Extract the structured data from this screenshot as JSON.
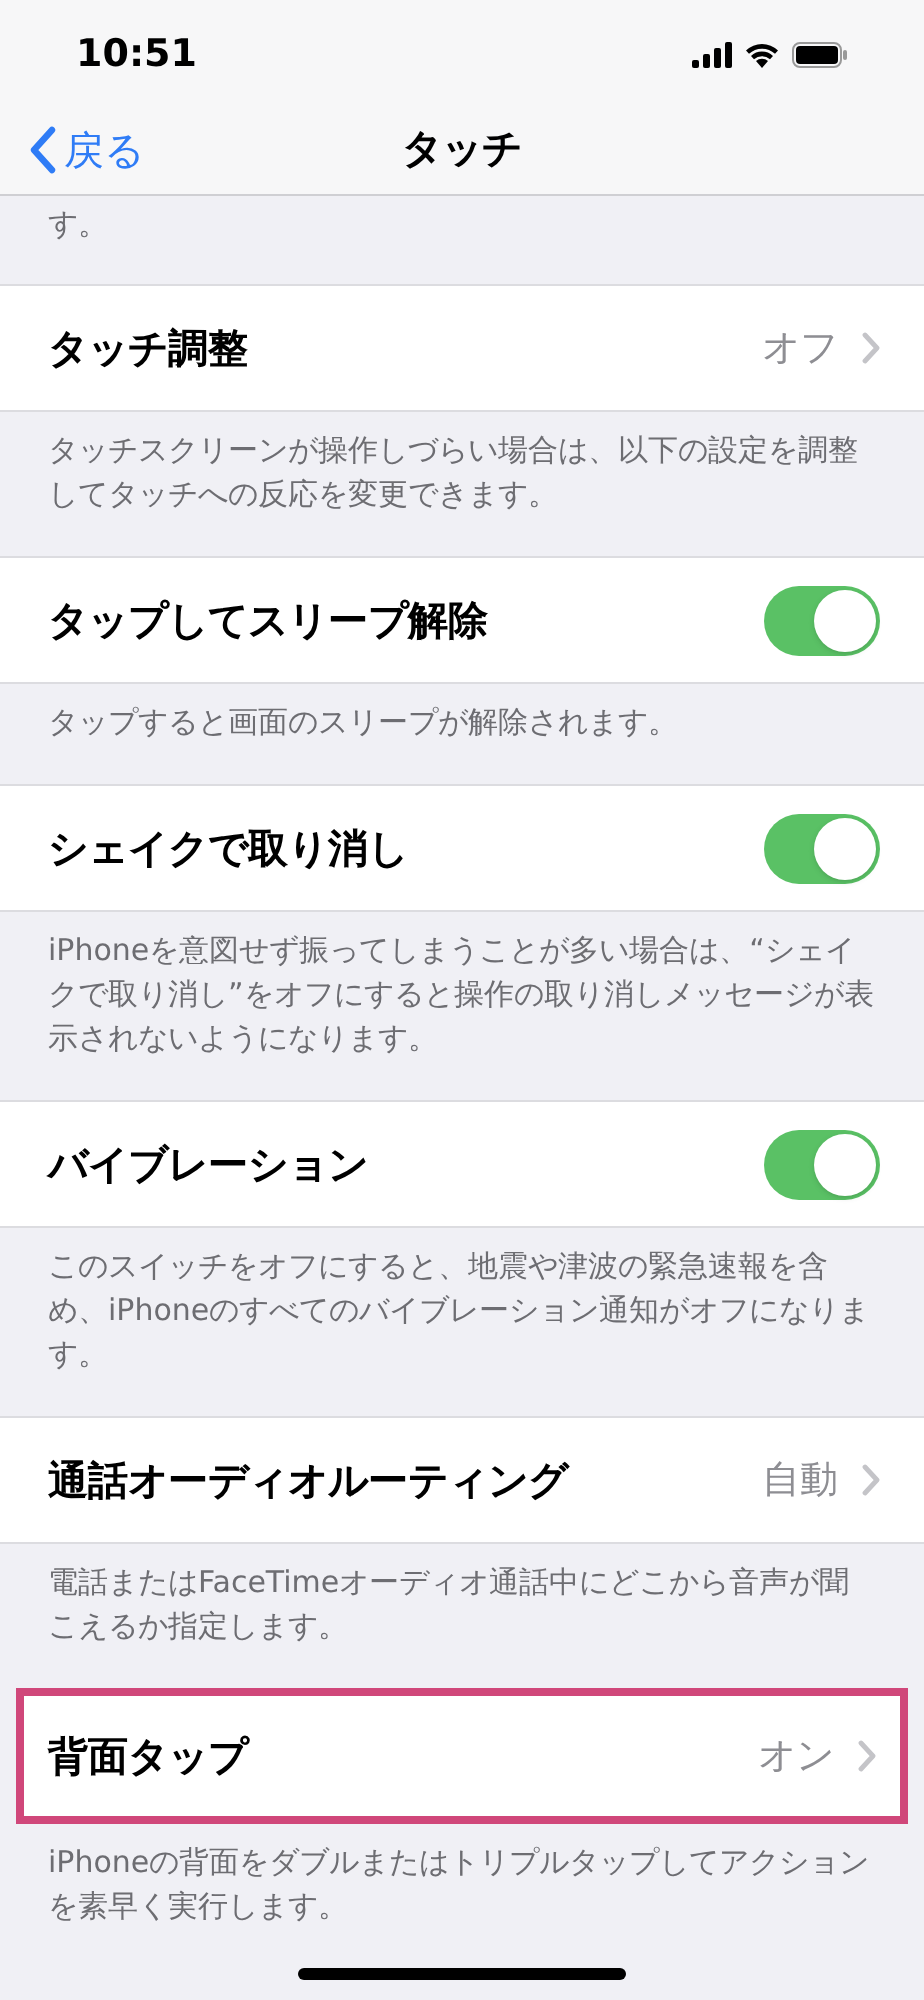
{
  "status_bar": {
    "time": "10:51"
  },
  "nav": {
    "back": "戻る",
    "title": "タッチ"
  },
  "top_footer": "す。",
  "sections": [
    {
      "kind": "disclosure",
      "label": "タッチ調整",
      "value": "オフ",
      "highlighted": false,
      "footer": "タッチスクリーンが操作しづらい場合は、以下の設定を調整してタッチへの反応を変更できます。"
    },
    {
      "kind": "toggle",
      "label": "タップしてスリープ解除",
      "on": true,
      "highlighted": false,
      "footer": "タップすると画面のスリープが解除されます。"
    },
    {
      "kind": "toggle",
      "label": "シェイクで取り消し",
      "on": true,
      "highlighted": false,
      "footer": "iPhoneを意図せず振ってしまうことが多い場合は、“シェイクで取り消し”をオフにすると操作の取り消しメッセージが表示されないようになります。"
    },
    {
      "kind": "toggle",
      "label": "バイブレーション",
      "on": true,
      "highlighted": false,
      "footer": "このスイッチをオフにすると、地震や津波の緊急速報を含め、iPhoneのすべてのバイブレーション通知がオフになります。"
    },
    {
      "kind": "disclosure",
      "label": "通話オーディオルーティング",
      "value": "自動",
      "highlighted": false,
      "footer": "電話またはFaceTimeオーディオ通話中にどこから音声が聞こえるか指定します。"
    },
    {
      "kind": "disclosure",
      "label": "背面タップ",
      "value": "オン",
      "highlighted": true,
      "footer": "iPhoneの背面をダブルまたはトリプルタップしてアクションを素早く実行します。"
    }
  ]
}
